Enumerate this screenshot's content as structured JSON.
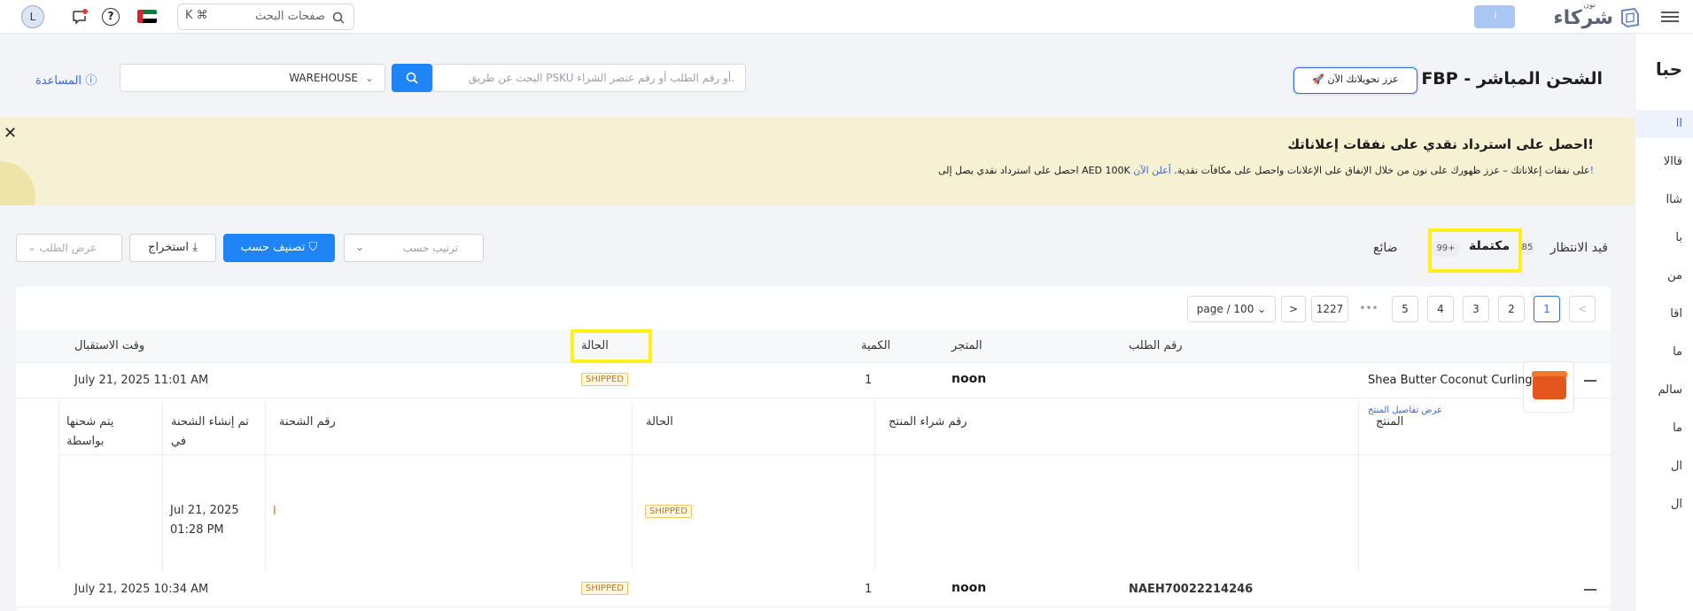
{
  "topbar": {
    "brand": "شركاء",
    "brand_sup": "نون",
    "search_placeholder": "صفحات البحث",
    "search_kbd": "K ⌘",
    "avatar_initial": "L"
  },
  "sidebar": {
    "title": "حبا",
    "items": [
      "اا",
      "قاالا",
      "شاا",
      "با",
      "من",
      "اقا",
      "ما",
      "سالم",
      "ما",
      "ال",
      "ال"
    ]
  },
  "header": {
    "title": "FBP - الشحن المباشر",
    "boost_label": "عزز تحويلاتك الآن",
    "search_placeholder": "البحث عن طريق PSKU أو رقم الطلب أو رقم عنصر الشراء.",
    "warehouse_value": "WAREHOUSE",
    "help_label": "المساعدة"
  },
  "banner": {
    "headline": "احصل على استرداد نقدي على نفقات إعلاناتك!",
    "body": "احصل على استرداد نقدي يصل إلى AED 100K على نفقات إعلاناتك – عزز ظهورك على نون من خلال الإنفاق على الإعلانات واحصل على مكافآت نقدية.",
    "link": "أعلن الآن!"
  },
  "tabs": {
    "pending_label": "قيد الانتظار",
    "pending_count": "85",
    "completed_label": "مكتملة",
    "completed_count": "99+",
    "lost_label": "ضائع"
  },
  "toolbar": {
    "sort_placeholder": "ترتيب حسب",
    "filter_label": "تصنيف حسب",
    "export_label": "استخراج",
    "view_placeholder": "عرض الطلب"
  },
  "pager": {
    "pages": [
      "1",
      "2",
      "3",
      "4",
      "5"
    ],
    "ellipsis": "•••",
    "last": "1227",
    "next": ">",
    "prev": "<",
    "per_page": "page / 100"
  },
  "table": {
    "headers": {
      "order_no": "رقم الطلب",
      "store": "المتجر",
      "qty": "الكمية",
      "status": "الحالة",
      "received": "وقت الاستقبال"
    },
    "rows": [
      {
        "order_no": "",
        "store": "noon",
        "qty": "1",
        "status": "SHIPPED",
        "received": "July 21, 2025 11:01 AM"
      },
      {
        "order_no": "NAEH70022214246",
        "store": "noon",
        "qty": "1",
        "status": "SHIPPED",
        "received": "July 21, 2025 10:34 AM"
      }
    ],
    "sub": {
      "headers": {
        "product": "المنتج",
        "purchase_no": "رقم شراء المنتج",
        "status": "الحالة",
        "shipment_no": "رقم الشحنة",
        "created_at": "تم إنشاء الشحنة في",
        "shipped_by": "يتم شحنها بواسطة"
      },
      "item": {
        "name": "Shea Butter Coconut Curling",
        "details_link": "عرض تفاصيل المنتج",
        "status": "SHIPPED",
        "shipment_no": "I",
        "created_at": "Jul 21, 2025 01:28 PM"
      }
    }
  },
  "colors": {
    "accent": "#1f85f7",
    "highlight": "#ffef1a",
    "shipped": "#b7791f",
    "banner_bg": "#f6f1d2"
  }
}
